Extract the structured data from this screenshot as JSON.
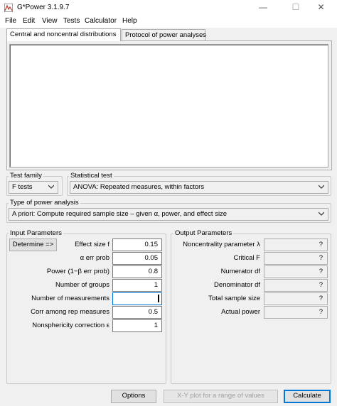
{
  "window": {
    "title": "G*Power 3.1.9.7",
    "min_glyph": "—",
    "max_glyph": "☐",
    "close_glyph": "✕"
  },
  "menu": [
    "File",
    "Edit",
    "View",
    "Tests",
    "Calculator",
    "Help"
  ],
  "tabs": [
    "Central and noncentral distributions",
    "Protocol of power analyses"
  ],
  "test_family": {
    "label": "Test family",
    "value": "F tests"
  },
  "statistical_test": {
    "label": "Statistical test",
    "value": "ANOVA: Repeated measures, within factors"
  },
  "power_analysis": {
    "label": "Type of power analysis",
    "value": "A priori: Compute required sample size – given α, power, and effect size"
  },
  "input": {
    "label": "Input Parameters",
    "determine_label": "Determine =>",
    "rows": [
      {
        "label": "Effect size f",
        "value": "0.15"
      },
      {
        "label": "α err prob",
        "value": "0.05"
      },
      {
        "label": "Power (1−β err prob)",
        "value": "0.8"
      },
      {
        "label": "Number of groups",
        "value": "1"
      },
      {
        "label": "Number of measurements",
        "value": ""
      },
      {
        "label": "Corr among rep measures",
        "value": "0.5"
      },
      {
        "label": "Nonsphericity correction ε",
        "value": "1"
      }
    ]
  },
  "output": {
    "label": "Output Parameters",
    "rows": [
      {
        "label": "Noncentrality parameter λ",
        "value": "?"
      },
      {
        "label": "Critical F",
        "value": "?"
      },
      {
        "label": "Numerator df",
        "value": "?"
      },
      {
        "label": "Denominator df",
        "value": "?"
      },
      {
        "label": "Total sample size",
        "value": "?"
      },
      {
        "label": "Actual power",
        "value": "?"
      }
    ]
  },
  "buttons": {
    "options": "Options",
    "xy_plot": "X-Y plot for a range of values",
    "calculate": "Calculate"
  }
}
